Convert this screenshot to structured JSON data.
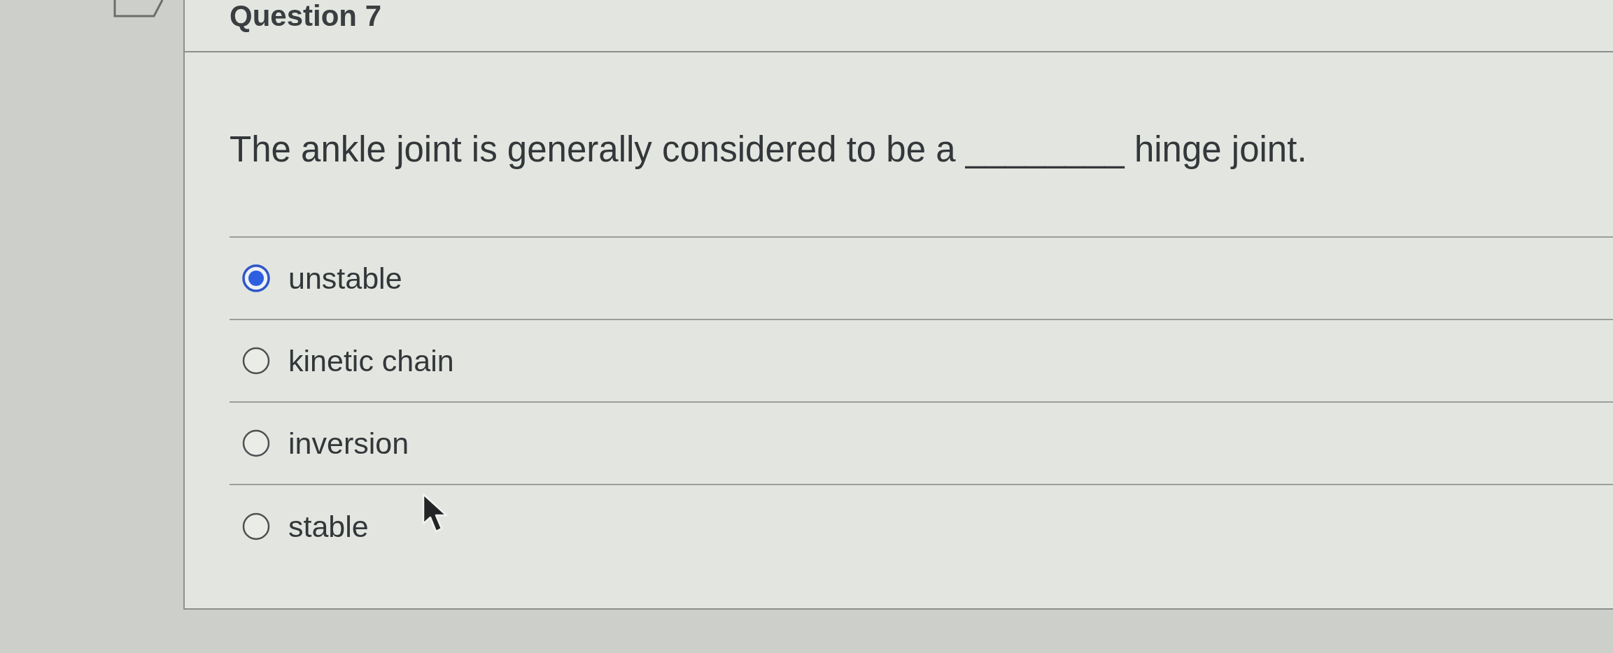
{
  "question": {
    "title": "Question 7",
    "text": "The ankle joint is generally considered to be a ________ hinge joint."
  },
  "options": [
    {
      "label": "unstable",
      "selected": true
    },
    {
      "label": "kinetic chain",
      "selected": false
    },
    {
      "label": "inversion",
      "selected": false
    },
    {
      "label": "stable",
      "selected": false
    }
  ]
}
